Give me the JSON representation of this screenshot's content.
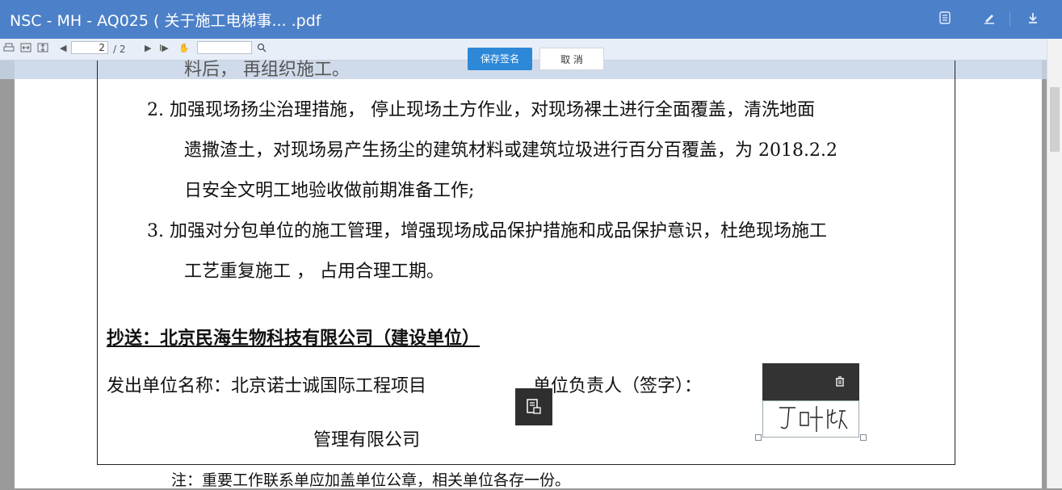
{
  "window": {
    "title": "NSC - MH - AQ025 ( 关于施工电梯事...  .pdf",
    "icons": [
      "list-icon",
      "edit-icon",
      "download-icon"
    ]
  },
  "toolbar": {
    "page_current": "2",
    "page_total": "/ 2",
    "search_placeholder": ""
  },
  "sign_actions": {
    "save_label": "保存签名",
    "cancel_label": "取 消"
  },
  "document": {
    "partial_line": "料后， 再组织施工。",
    "item2_line1": "2. 加强现场扬尘治理措施， 停止现场土方作业，对现场裸土进行全面覆盖，清洗地面",
    "item2_line2": "遗撒渣土，对现场易产生扬尘的建筑材料或建筑垃圾进行百分百覆盖，为 2018.2.2",
    "item2_line3": "日安全文明工地验收做前期准备工作;",
    "item3_line1": "3. 加强对分包单位的施工管理，增强现场成品保护措施和成品保护意识，杜绝现场施工",
    "item3_line2": "工艺重复施工 ， 占用合理工期。",
    "cc_line": "抄送：北京民海生物科技有限公司（建设单位）",
    "issuer_label": "发出单位名称：北京诺士诚国际工程项目",
    "issuer_line2": "管理有限公司",
    "responsible_label": "单位负责人（签字）：",
    "note": "注：重要工作联系单应加盖单位公章，相关单位各存一份。"
  },
  "signature": {
    "text": "丁叶欣"
  },
  "colors": {
    "titlebar": "#4c80c8",
    "primary_button": "#2d88d8"
  }
}
